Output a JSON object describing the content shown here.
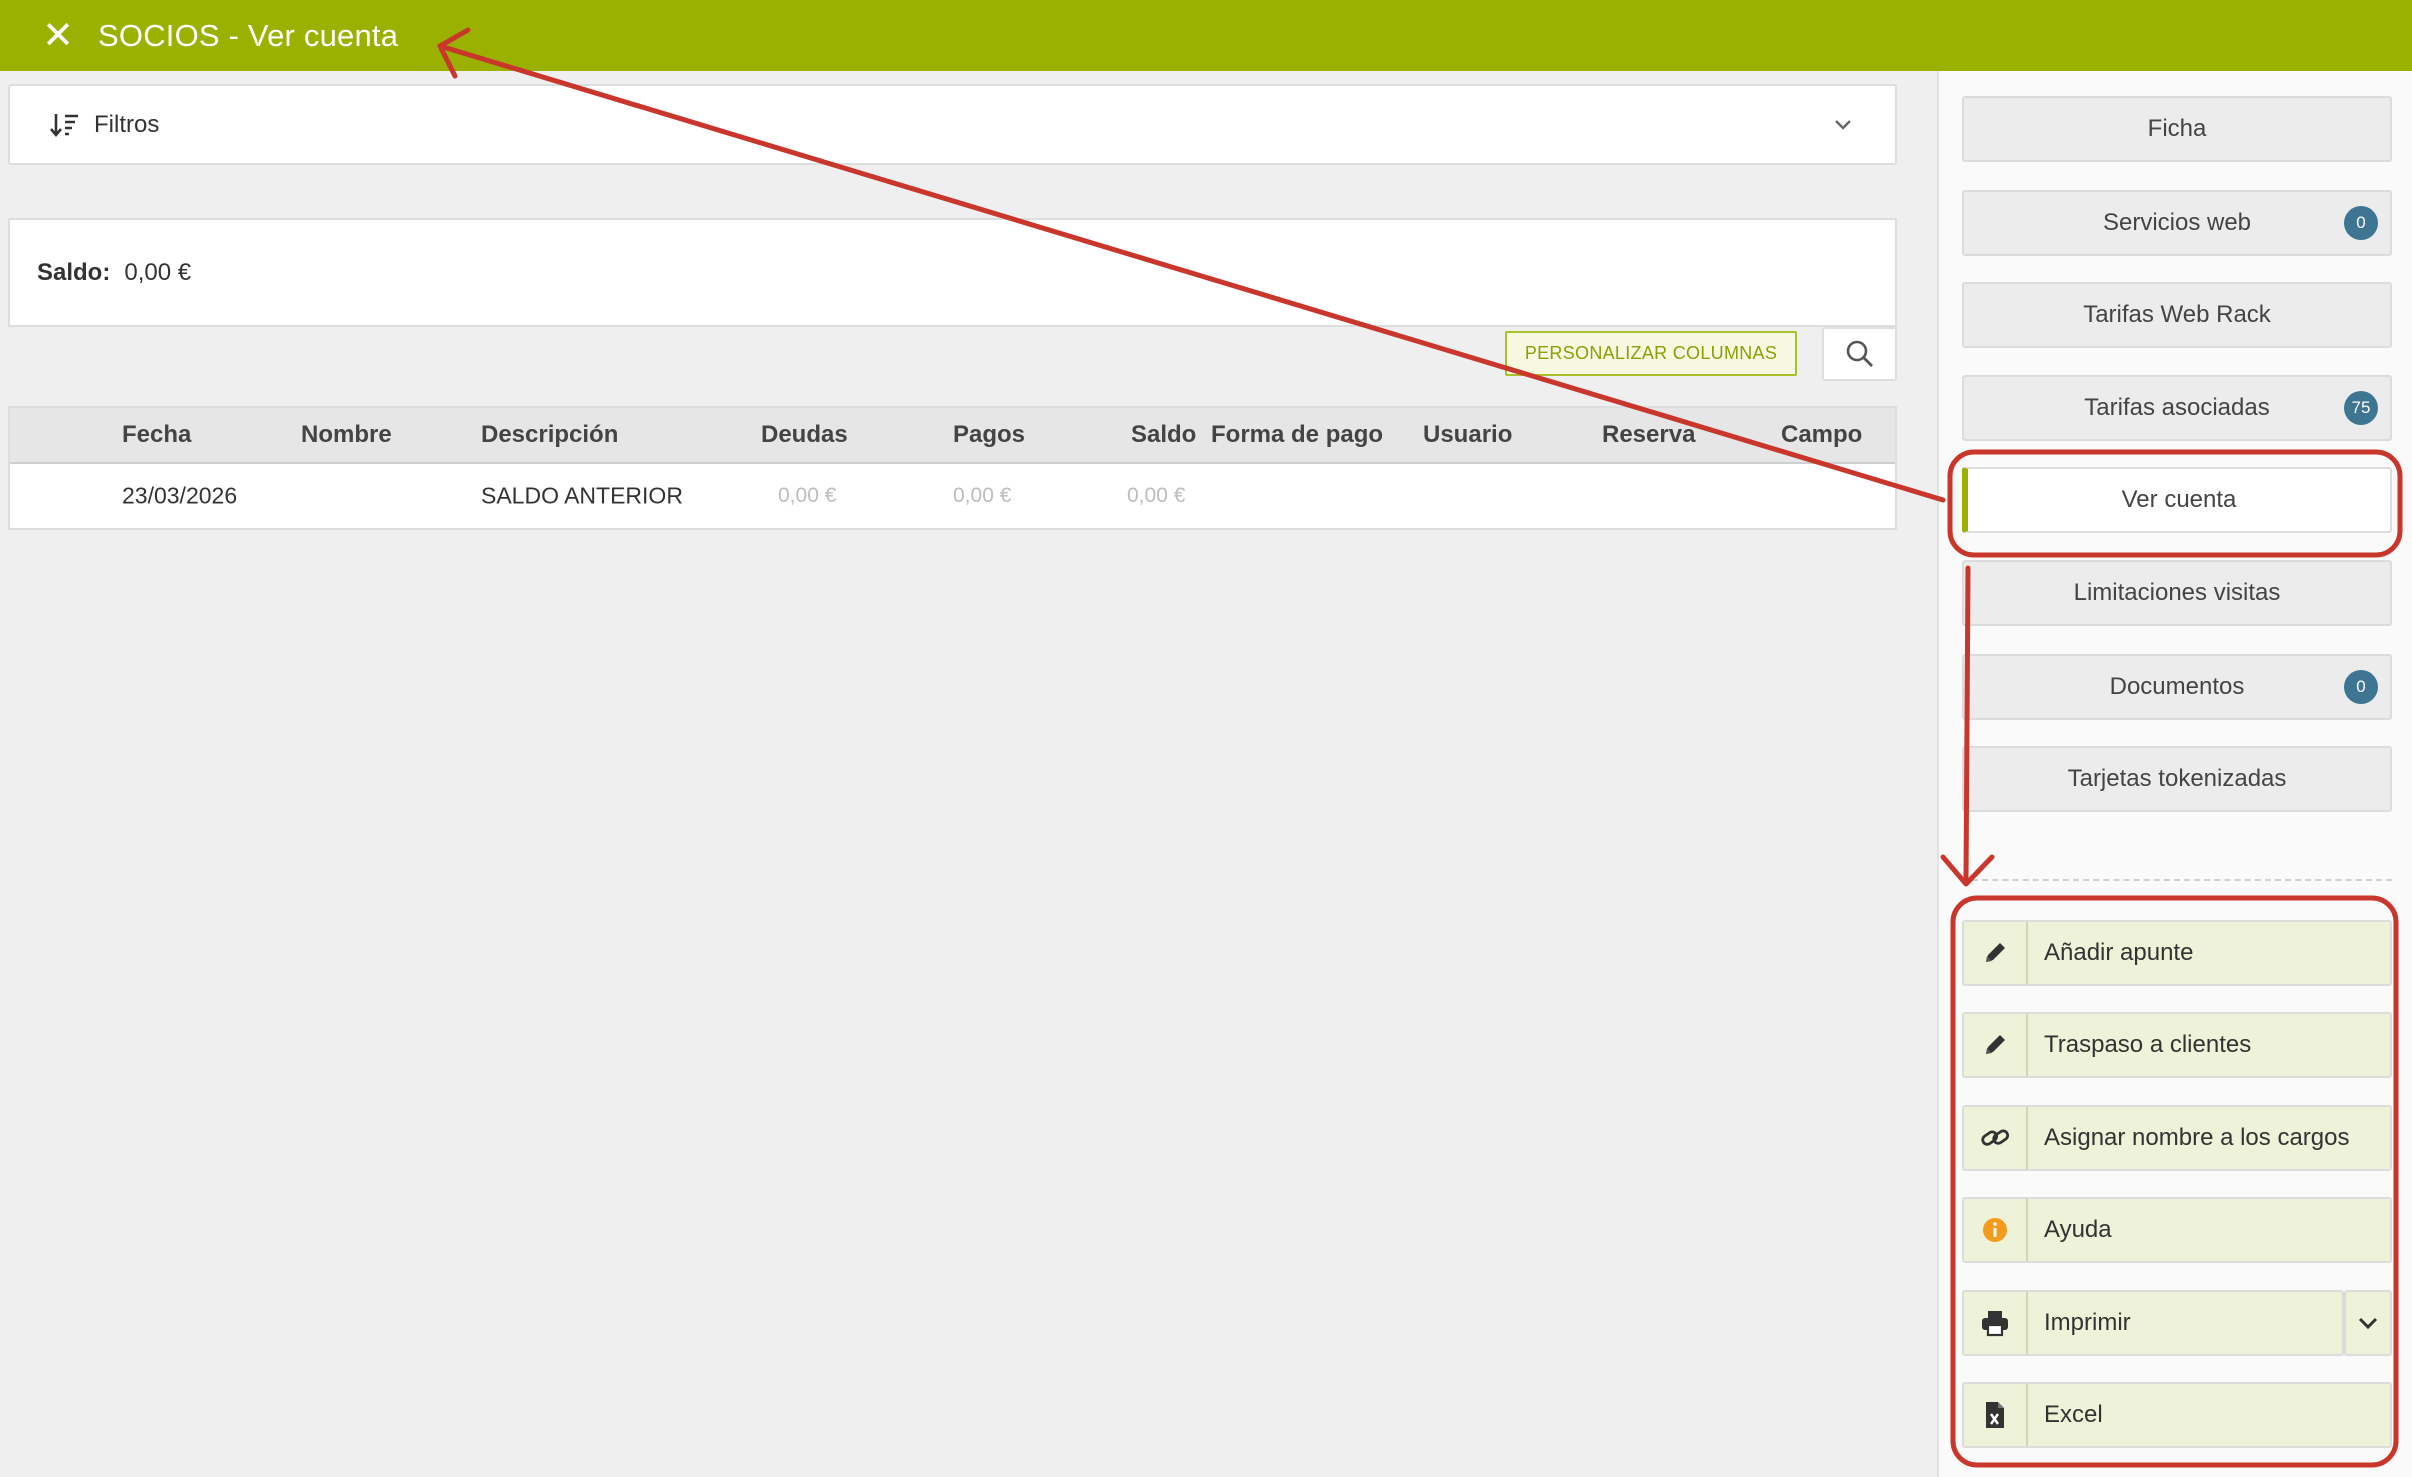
{
  "header": {
    "title": "SOCIOS - Ver cuenta",
    "close_glyph": "✕"
  },
  "filters": {
    "label": "Filtros"
  },
  "saldo": {
    "label": "Saldo:",
    "value": "0,00 €"
  },
  "toolbar": {
    "personalizar_label": "PERSONALIZAR COLUMNAS"
  },
  "table": {
    "columns": [
      "Fecha",
      "Nombre",
      "Descripción",
      "Deudas",
      "Pagos",
      "Saldo",
      "Forma de pago",
      "Usuario",
      "Reserva",
      "Campo"
    ],
    "rows": [
      {
        "fecha": "23/03/2026",
        "nombre": "",
        "descripcion": "SALDO ANTERIOR",
        "deudas": "0,00 €",
        "pagos": "0,00 €",
        "saldo": "0,00 €",
        "forma_pago": "",
        "usuario": "",
        "reserva": "",
        "campo": ""
      }
    ]
  },
  "nav": {
    "items": [
      {
        "label": "Ficha"
      },
      {
        "label": "Servicios web",
        "badge": "0"
      },
      {
        "label": "Tarifas Web Rack"
      },
      {
        "label": "Tarifas asociadas",
        "badge": "75"
      },
      {
        "label": "Ver cuenta"
      },
      {
        "label": "Limitaciones visitas"
      },
      {
        "label": "Documentos",
        "badge": "0"
      },
      {
        "label": "Tarjetas tokenizadas"
      }
    ]
  },
  "actions": {
    "items": [
      {
        "label": "Añadir apunte",
        "icon": "pencil-icon"
      },
      {
        "label": "Traspaso a clientes",
        "icon": "pencil-icon"
      },
      {
        "label": "Asignar nombre a los cargos",
        "icon": "link-icon"
      },
      {
        "label": "Ayuda",
        "icon": "info-icon"
      },
      {
        "label": "Imprimir",
        "icon": "printer-icon"
      },
      {
        "label": "Excel",
        "icon": "excel-file-icon"
      }
    ]
  },
  "colors": {
    "header_bg": "#9ab100",
    "accent": "#9ab100",
    "badge_bg": "#3e7592",
    "action_bg": "#eef2d8",
    "annotation_red": "#c8362c",
    "info_orange": "#f29b1d"
  }
}
